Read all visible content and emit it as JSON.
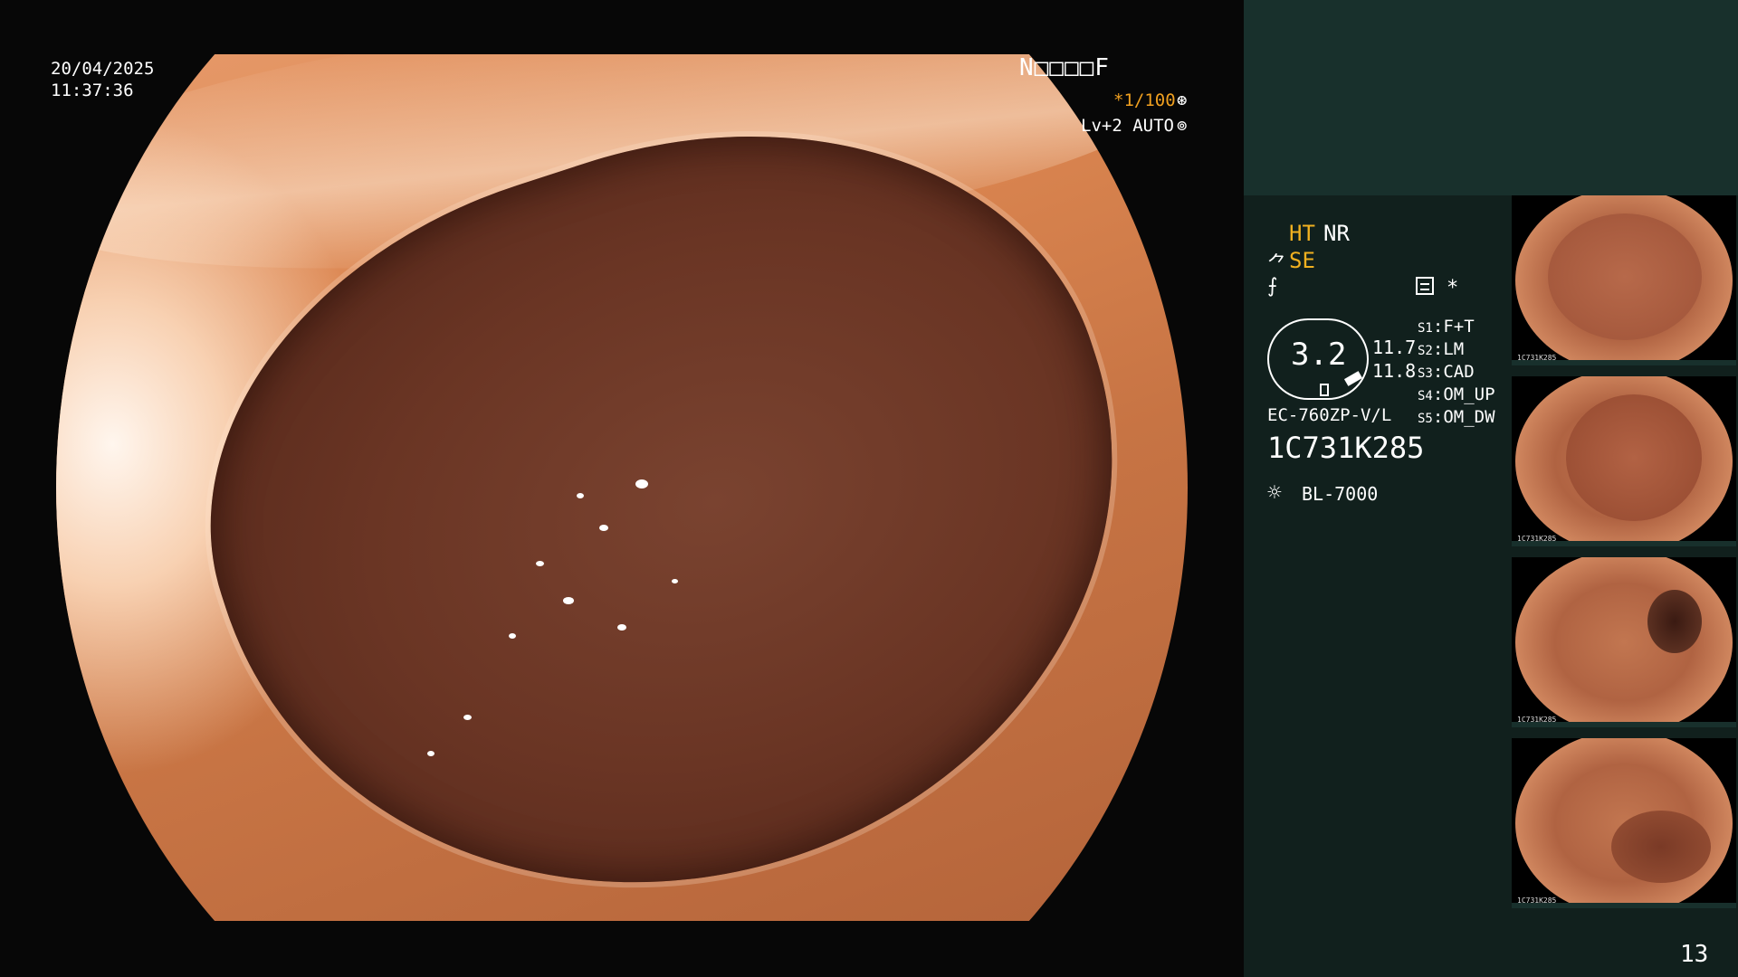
{
  "overlay": {
    "date": "20/04/2025",
    "time": "11:37:36",
    "scope_code": "N□□□□F",
    "shutter": "*1/100",
    "shutter_icon": "⊛",
    "level": "Lv+2 AUTO",
    "auto_icon": "⊚"
  },
  "panel": {
    "mode_ht": "HT",
    "mode_nr": "NR",
    "se_icon": "⺈",
    "mode_se": "SE",
    "f_icon": "⨍",
    "star_icon": "*",
    "gauge_value": "3.2",
    "gauge_v1": "11.7",
    "gauge_v2": "11.8",
    "settings": [
      {
        "key": "S1",
        "value": "F+T"
      },
      {
        "key": "S2",
        "value": "LM"
      },
      {
        "key": "S3",
        "value": "CAD"
      },
      {
        "key": "S4",
        "value": "OM_UP"
      },
      {
        "key": "S5",
        "value": "OM_DW"
      }
    ],
    "model": "EC-760ZP-V/L",
    "serial": "1C731K285",
    "bulb_icon": "☼",
    "light_source": "BL-7000"
  },
  "thumbnails": [
    {
      "label": "1C731K285",
      "tint": "#a85a3c"
    },
    {
      "label": "1C731K285",
      "tint": "#b96d48"
    },
    {
      "label": "1C731K285",
      "tint": "#c98a66"
    },
    {
      "label": "1C731K285",
      "tint": "#ad6446"
    }
  ],
  "page_number": "13"
}
